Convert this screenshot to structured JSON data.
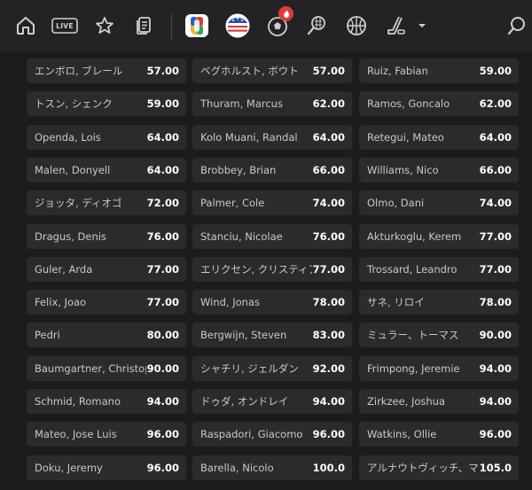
{
  "nav": {
    "live_label": "LIVE",
    "icons": [
      "home-icon",
      "live-icon",
      "star-icon",
      "betslip-icon",
      "euro-2024-icon",
      "copa-america-icon",
      "soccer-ball-icon",
      "tennis-icon",
      "basketball-icon",
      "hockey-icon",
      "chevron-down-icon",
      "search-icon"
    ],
    "badge_icon": "fire-icon",
    "accent": "#e03a3a"
  },
  "rows": [
    [
      {
        "name": "エンボロ, ブレール",
        "odds": "57.00"
      },
      {
        "name": "ベグホルスト, ボウト",
        "odds": "57.00"
      },
      {
        "name": "Ruiz, Fabian",
        "odds": "59.00"
      }
    ],
    [
      {
        "name": "トスン, シェンク",
        "odds": "59.00"
      },
      {
        "name": "Thuram, Marcus",
        "odds": "62.00"
      },
      {
        "name": "Ramos, Goncalo",
        "odds": "62.00"
      }
    ],
    [
      {
        "name": "Openda, Lois",
        "odds": "64.00"
      },
      {
        "name": "Kolo Muani, Randal",
        "odds": "64.00"
      },
      {
        "name": "Retegui, Mateo",
        "odds": "64.00"
      }
    ],
    [
      {
        "name": "Malen, Donyell",
        "odds": "64.00"
      },
      {
        "name": "Brobbey, Brian",
        "odds": "66.00"
      },
      {
        "name": "Williams, Nico",
        "odds": "66.00"
      }
    ],
    [
      {
        "name": "ジョッタ, ディオゴ",
        "odds": "72.00"
      },
      {
        "name": "Palmer, Cole",
        "odds": "74.00"
      },
      {
        "name": "Olmo, Dani",
        "odds": "74.00"
      }
    ],
    [
      {
        "name": "Dragus, Denis",
        "odds": "76.00"
      },
      {
        "name": "Stanciu, Nicolae",
        "odds": "76.00"
      },
      {
        "name": "Akturkoglu, Kerem",
        "odds": "77.00"
      }
    ],
    [
      {
        "name": "Guler, Arda",
        "odds": "77.00"
      },
      {
        "name": "エリクセン, クリスティアン",
        "odds": "77.00"
      },
      {
        "name": "Trossard, Leandro",
        "odds": "77.00"
      }
    ],
    [
      {
        "name": "Felix, Joao",
        "odds": "77.00"
      },
      {
        "name": "Wind, Jonas",
        "odds": "78.00"
      },
      {
        "name": "サネ, リロイ",
        "odds": "78.00"
      }
    ],
    [
      {
        "name": "Pedri",
        "odds": "80.00"
      },
      {
        "name": "Bergwijn, Steven",
        "odds": "83.00"
      },
      {
        "name": "ミュラー、トーマス",
        "odds": "90.00"
      }
    ],
    [
      {
        "name": "Baumgartner, Christoph",
        "odds": "90.00"
      },
      {
        "name": "シャチリ, ジェルダン",
        "odds": "92.00"
      },
      {
        "name": "Frimpong, Jeremie",
        "odds": "94.00"
      }
    ],
    [
      {
        "name": "Schmid, Romano",
        "odds": "94.00"
      },
      {
        "name": "ドゥダ, オンドレイ",
        "odds": "94.00"
      },
      {
        "name": "Zirkzee, Joshua",
        "odds": "94.00"
      }
    ],
    [
      {
        "name": "Mateo, Jose Luis",
        "odds": "96.00"
      },
      {
        "name": "Raspadori, Giacomo",
        "odds": "96.00"
      },
      {
        "name": "Watkins, Ollie",
        "odds": "96.00"
      }
    ],
    [
      {
        "name": "Doku, Jeremy",
        "odds": "96.00"
      },
      {
        "name": "Barella, Nicolo",
        "odds": "100.0"
      },
      {
        "name": "アルナウトヴィッチ、マルコ",
        "odds": "105.0"
      }
    ]
  ]
}
